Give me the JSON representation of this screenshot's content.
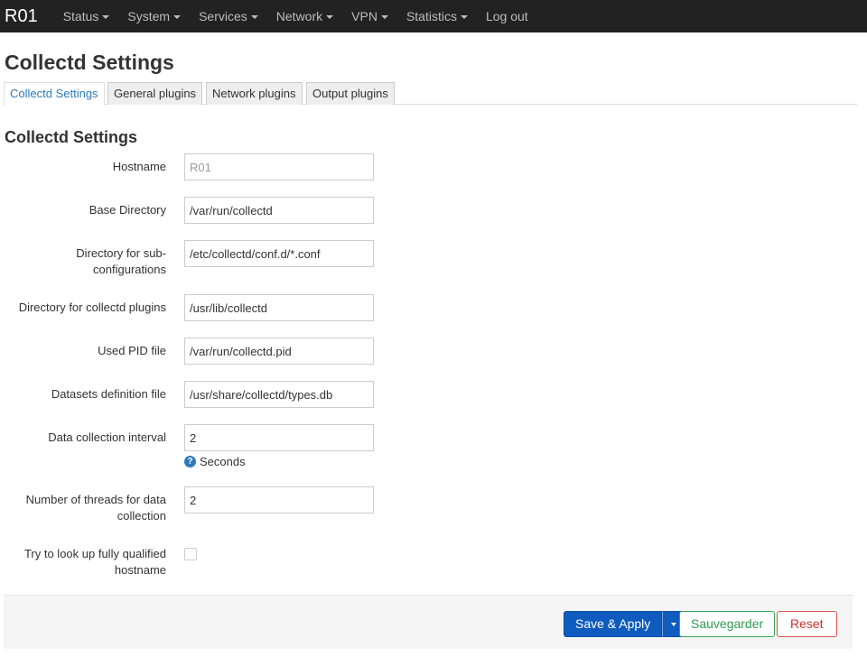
{
  "navbar": {
    "brand": "R01",
    "menus": [
      {
        "label": "Status",
        "has_dropdown": true
      },
      {
        "label": "System",
        "has_dropdown": true
      },
      {
        "label": "Services",
        "has_dropdown": true
      },
      {
        "label": "Network",
        "has_dropdown": true
      },
      {
        "label": "VPN",
        "has_dropdown": true
      },
      {
        "label": "Statistics",
        "has_dropdown": true
      },
      {
        "label": "Log out",
        "has_dropdown": false
      }
    ]
  },
  "page": {
    "title": "Collectd Settings",
    "tabs": [
      {
        "label": "Collectd Settings",
        "active": true
      },
      {
        "label": "General plugins",
        "active": false
      },
      {
        "label": "Network plugins",
        "active": false
      },
      {
        "label": "Output plugins",
        "active": false
      }
    ],
    "section_title": "Collectd Settings"
  },
  "form": {
    "hostname": {
      "label": "Hostname",
      "value": "",
      "placeholder": "R01"
    },
    "base_directory": {
      "label": "Base Directory",
      "value": "/var/run/collectd"
    },
    "subconfig_directory": {
      "label": "Directory for sub-configurations",
      "value": "/etc/collectd/conf.d/*.conf"
    },
    "plugins_directory": {
      "label": "Directory for collectd plugins",
      "value": "/usr/lib/collectd"
    },
    "pid_file": {
      "label": "Used PID file",
      "value": "/var/run/collectd.pid"
    },
    "datasets_file": {
      "label": "Datasets definition file",
      "value": "/usr/share/collectd/types.db"
    },
    "interval": {
      "label": "Data collection interval",
      "value": "2",
      "help": "Seconds",
      "help_icon": "question-circle-icon"
    },
    "threads": {
      "label": "Number of threads for data collection",
      "value": "2"
    },
    "fqdn_lookup": {
      "label": "Try to look up fully qualified hostname",
      "checked": false
    }
  },
  "actions": {
    "save_apply": "Save & Apply",
    "save": "Sauvegarder",
    "reset": "Reset"
  },
  "colors": {
    "navbar_bg": "#222222",
    "accent": "#2a7bbd",
    "primary_button": "#0f5cbe",
    "save_button": "#2e9d4e",
    "reset_button": "#c9302c"
  }
}
